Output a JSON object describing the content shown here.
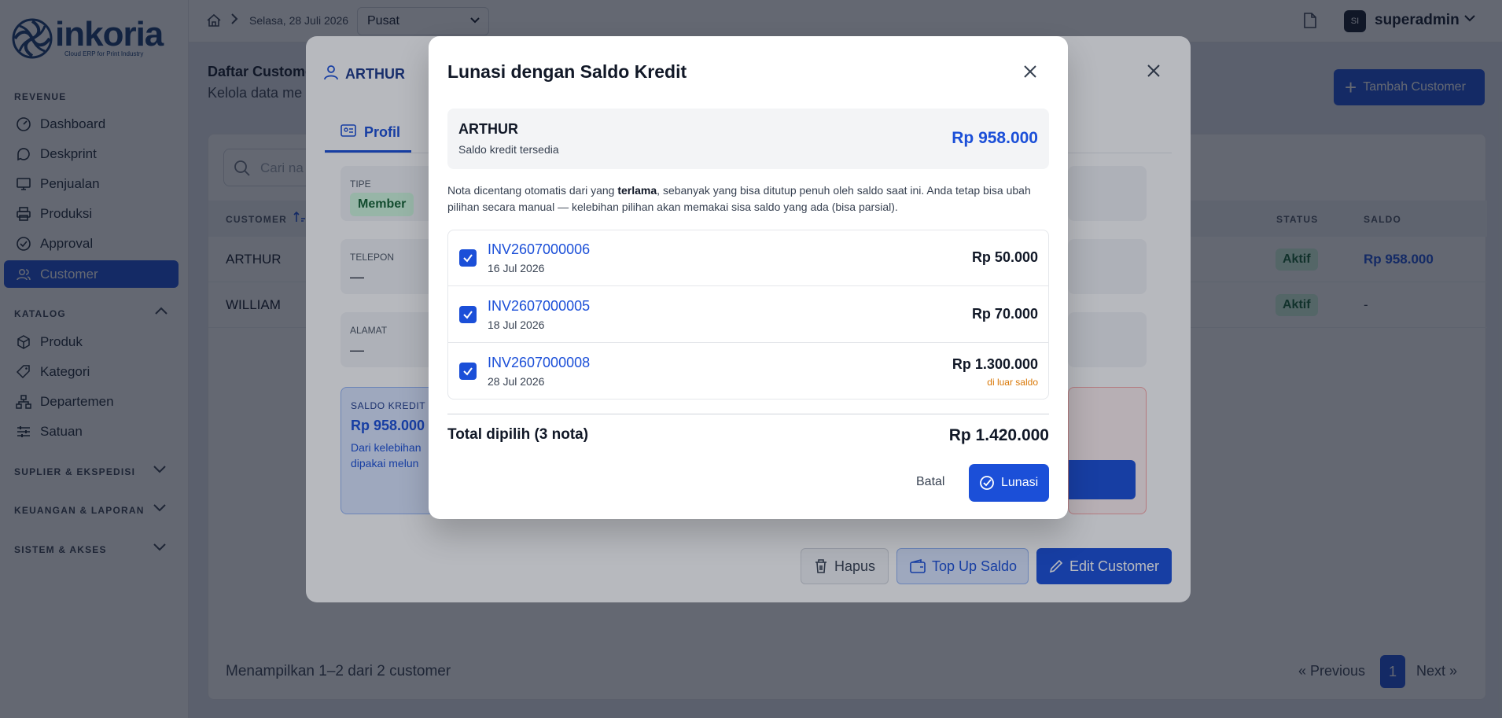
{
  "app": {
    "logo_word": "inkoria",
    "logo_tagline": "Cloud ERP for Print Industry"
  },
  "sidebar": {
    "revenue_label": "REVENUE",
    "revenue_items": [
      {
        "label": "Dashboard",
        "icon": "dashboard-icon"
      },
      {
        "label": "Deskprint",
        "icon": "chat-icon"
      },
      {
        "label": "Penjualan",
        "icon": "monitor-icon"
      },
      {
        "label": "Produksi",
        "icon": "printer-icon"
      },
      {
        "label": "Approval",
        "icon": "check-circle-icon"
      },
      {
        "label": "Customer",
        "icon": "users-icon",
        "active": true
      }
    ],
    "katalog_label": "KATALOG",
    "katalog_items": [
      {
        "label": "Produk",
        "icon": "box-icon"
      },
      {
        "label": "Kategori",
        "icon": "tag-icon"
      },
      {
        "label": "Departemen",
        "icon": "org-icon"
      },
      {
        "label": "Satuan",
        "icon": "sliders-icon"
      }
    ],
    "collapsed_sections": [
      "SUPLIER & EKSPEDISI",
      "KEUANGAN & LAPORAN",
      "SISTEM & AKSES"
    ]
  },
  "topbar": {
    "date": "Selasa, 28 Juli 2026",
    "branch": "Pusat",
    "user_initials": "SI",
    "user_name": "superadmin"
  },
  "page": {
    "title": "Daftar Customer",
    "subtitle": "Kelola data me",
    "add_button": "Tambah Customer",
    "search_placeholder": "Cari na",
    "columns": {
      "customer": "CUSTOMER",
      "status": "STATUS",
      "saldo": "SALDO"
    },
    "rows": [
      {
        "name": "ARTHUR",
        "status": "Aktif",
        "saldo": "Rp 958.000"
      },
      {
        "name": "WILLIAM",
        "status": "Aktif",
        "saldo": "-"
      }
    ],
    "footer": "Menampilkan 1–2 dari 2 customer",
    "pager": {
      "previous": "« Previous",
      "page": "1",
      "next": "Next »"
    }
  },
  "customer_modal": {
    "name": "ARTHUR",
    "tab": "Profil",
    "tipe_label": "TIPE",
    "tipe_value": "Member",
    "telepon_label": "TELEPON",
    "telepon_value": "—",
    "alamat_label": "ALAMAT",
    "alamat_value": "—",
    "saldo_label": "SALDO KREDIT",
    "saldo_value": "Rp 958.000",
    "saldo_desc_1": "Dari kelebihan",
    "saldo_desc_2": "dipakai melun",
    "buttons": {
      "hapus": "Hapus",
      "topup": "Top Up Saldo",
      "edit": "Edit Customer"
    }
  },
  "pay_modal": {
    "title": "Lunasi dengan Saldo Kredit",
    "customer": "ARTHUR",
    "available_label": "Saldo kredit tersedia",
    "available_amount": "Rp 958.000",
    "note_pre": "Nota dicentang otomatis dari yang ",
    "note_bold": "terlama",
    "note_post": ", sebanyak yang bisa ditutup penuh oleh saldo saat ini. Anda tetap bisa ubah pilihan secara manual — kelebihan pilihan akan memakai sisa saldo yang ada (bisa parsial).",
    "invoices": [
      {
        "number": "INV2607000006",
        "date": "16 Jul 2026",
        "amount": "Rp 50.000",
        "checked": true,
        "warning": ""
      },
      {
        "number": "INV2607000005",
        "date": "18 Jul 2026",
        "amount": "Rp 70.000",
        "checked": true,
        "warning": ""
      },
      {
        "number": "INV2607000008",
        "date": "28 Jul 2026",
        "amount": "Rp 1.300.000",
        "checked": true,
        "warning": "di luar saldo"
      }
    ],
    "total_label": "Total dipilih (3 nota)",
    "total_amount": "Rp 1.420.000",
    "cancel": "Batal",
    "confirm": "Lunasi"
  },
  "colors": {
    "primary": "#1b4fd8",
    "success_bg": "#d1fadf",
    "success_text": "#166534",
    "warning": "#d97706"
  }
}
